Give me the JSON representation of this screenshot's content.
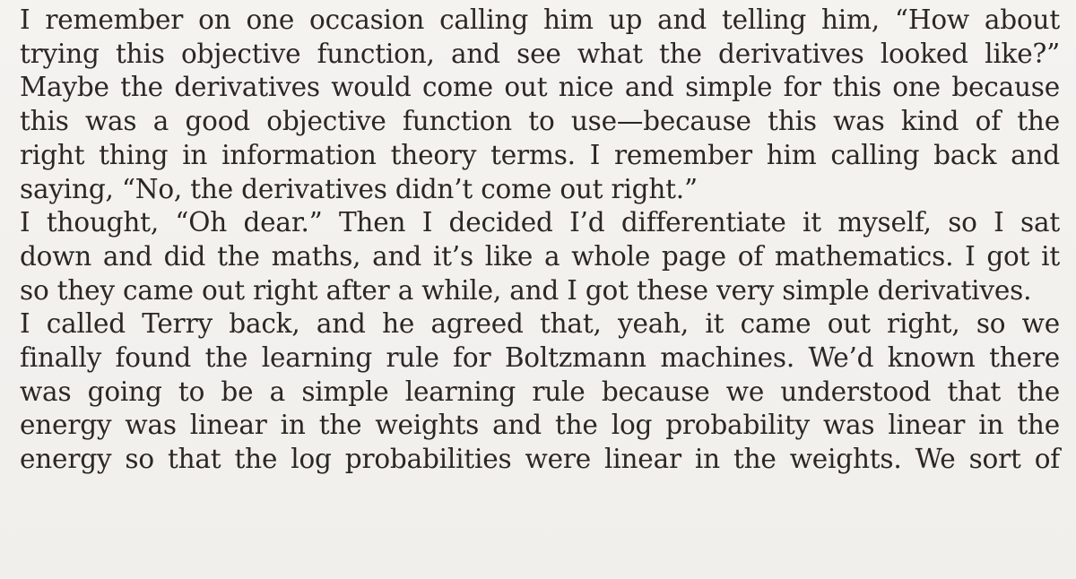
{
  "document": {
    "paragraphs": [
      {
        "lines": [
          "I remember on one occasion calling him up and telling him, “How about",
          "trying this objective function, and see what the derivatives looked like?”",
          "Maybe the derivatives would come out nice and simple for this one because",
          "this was a good objective function to use—because this was kind of the",
          "right thing in information theory terms. I remember him calling back and",
          "saying, “No, the derivatives didn’t come out right.”"
        ]
      },
      {
        "lines": [
          "I thought, “Oh dear.” Then I decided I’d differentiate it myself, so I sat",
          "down and did the maths, and it’s like a whole page of mathematics. I got it",
          "so they came out right after a while, and I got these very simple derivatives."
        ]
      },
      {
        "lines": [
          "I called Terry back, and he agreed that, yeah, it came out right, so we",
          "finally found the learning rule for Boltzmann machines. We’d known there",
          "was going to be a simple learning rule because we understood that the",
          "energy was linear in the weights and the log probability was linear in the",
          "energy so that the log probabilities were linear in the weights. We sort of"
        ]
      }
    ]
  }
}
